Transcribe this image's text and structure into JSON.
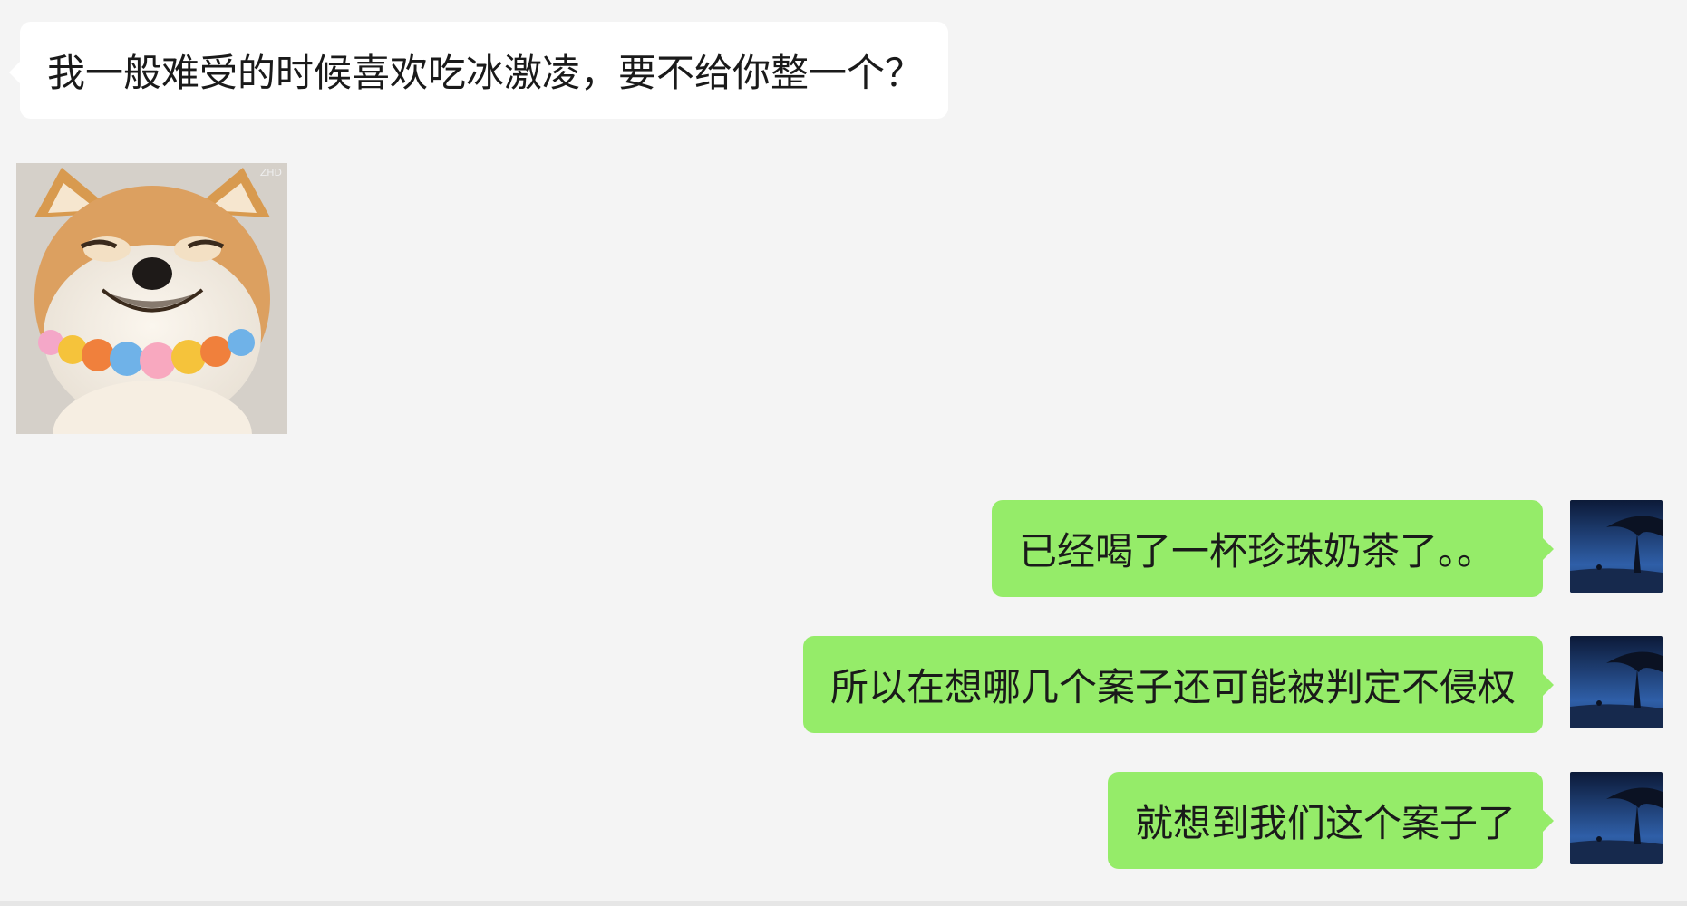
{
  "messages": [
    {
      "side": "left",
      "type": "text",
      "text": "我一般难受的时候喜欢吃冰激凌，要不给你整一个？"
    },
    {
      "side": "left",
      "type": "sticker",
      "sticker_name": "shiba-inu-smiling-sticker",
      "corner_text": "ZHD"
    },
    {
      "side": "right",
      "type": "text",
      "text": "已经喝了一杯珍珠奶茶了。。"
    },
    {
      "side": "right",
      "type": "text",
      "text": "所以在想哪几个案子还可能被判定不侵权"
    },
    {
      "side": "right",
      "type": "text",
      "text": "就想到我们这个案子了"
    }
  ],
  "colors": {
    "background": "#f4f4f4",
    "incoming_bubble": "#ffffff",
    "outgoing_bubble": "#95ec69",
    "text": "#1a1a1a"
  },
  "avatar": {
    "icon": "night-tree-avatar-icon"
  }
}
